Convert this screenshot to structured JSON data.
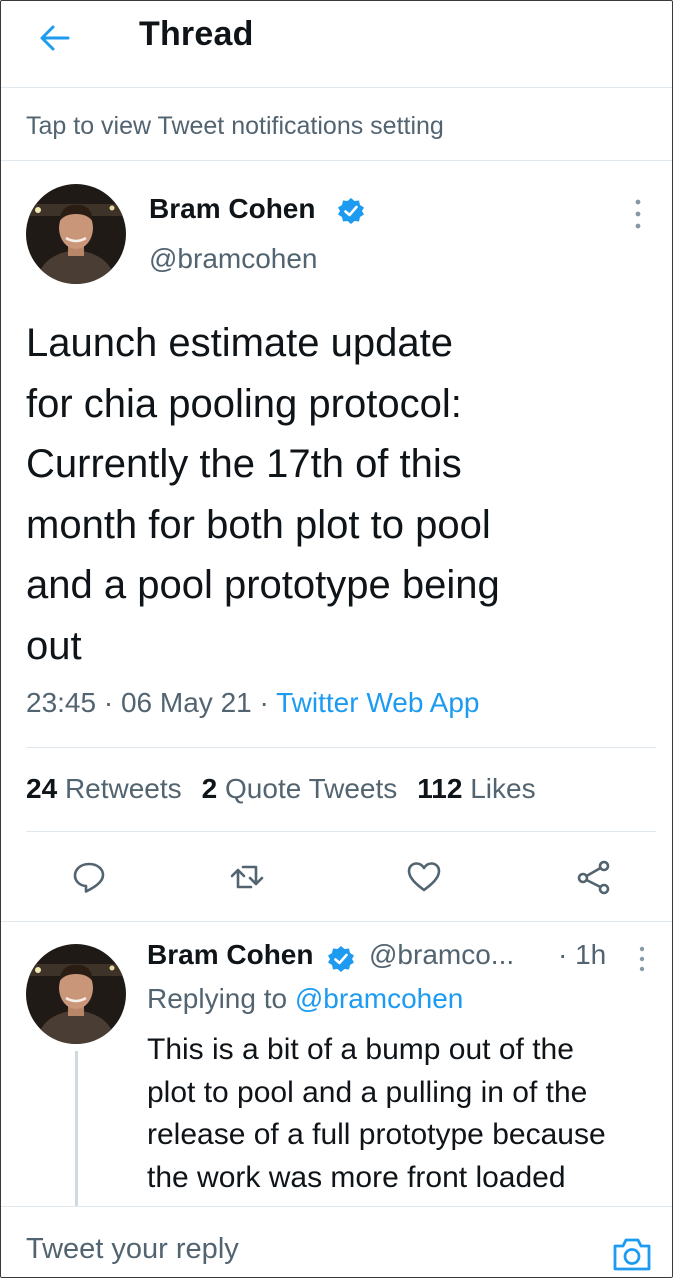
{
  "header": {
    "title": "Thread",
    "back_icon": "arrow-left-icon"
  },
  "notice": {
    "text": "Tap to view Tweet notifications setting"
  },
  "tweet": {
    "author_name": "Bram Cohen",
    "author_handle": "@bramcohen",
    "verified_icon": "verified-badge-icon",
    "text": "Launch estimate update\nfor chia pooling protocol:\nCurrently the 17th of this\nmonth for both plot to pool\nand a pool prototype being\nout",
    "time": "23:45",
    "date": "06 May 21",
    "separator": " · ",
    "source": "Twitter Web App",
    "stats": {
      "retweets_count": "24",
      "retweets_label": "Retweets",
      "quote_count": "2",
      "quote_label": "Quote Tweets",
      "likes_count": "112",
      "likes_label": "Likes"
    },
    "actions": [
      "reply-icon",
      "retweet-icon",
      "like-icon",
      "share-icon"
    ]
  },
  "reply": {
    "author_name": "Bram Cohen",
    "author_handle": "@bramco...",
    "time": "· 1h",
    "replying_prefix": "Replying to",
    "replying_to": "@bramcohen",
    "text": "This is a bit of a bump out of the\nplot to pool and a pulling in of the\nrelease of a full prototype because\nthe work was more front loaded"
  },
  "compose": {
    "placeholder": "Tweet your reply",
    "camera_icon": "camera-icon"
  },
  "colors": {
    "accent": "#1d9bf0",
    "text": "#0f1419",
    "secondary": "#536471",
    "divider": "#e1e8ed"
  }
}
